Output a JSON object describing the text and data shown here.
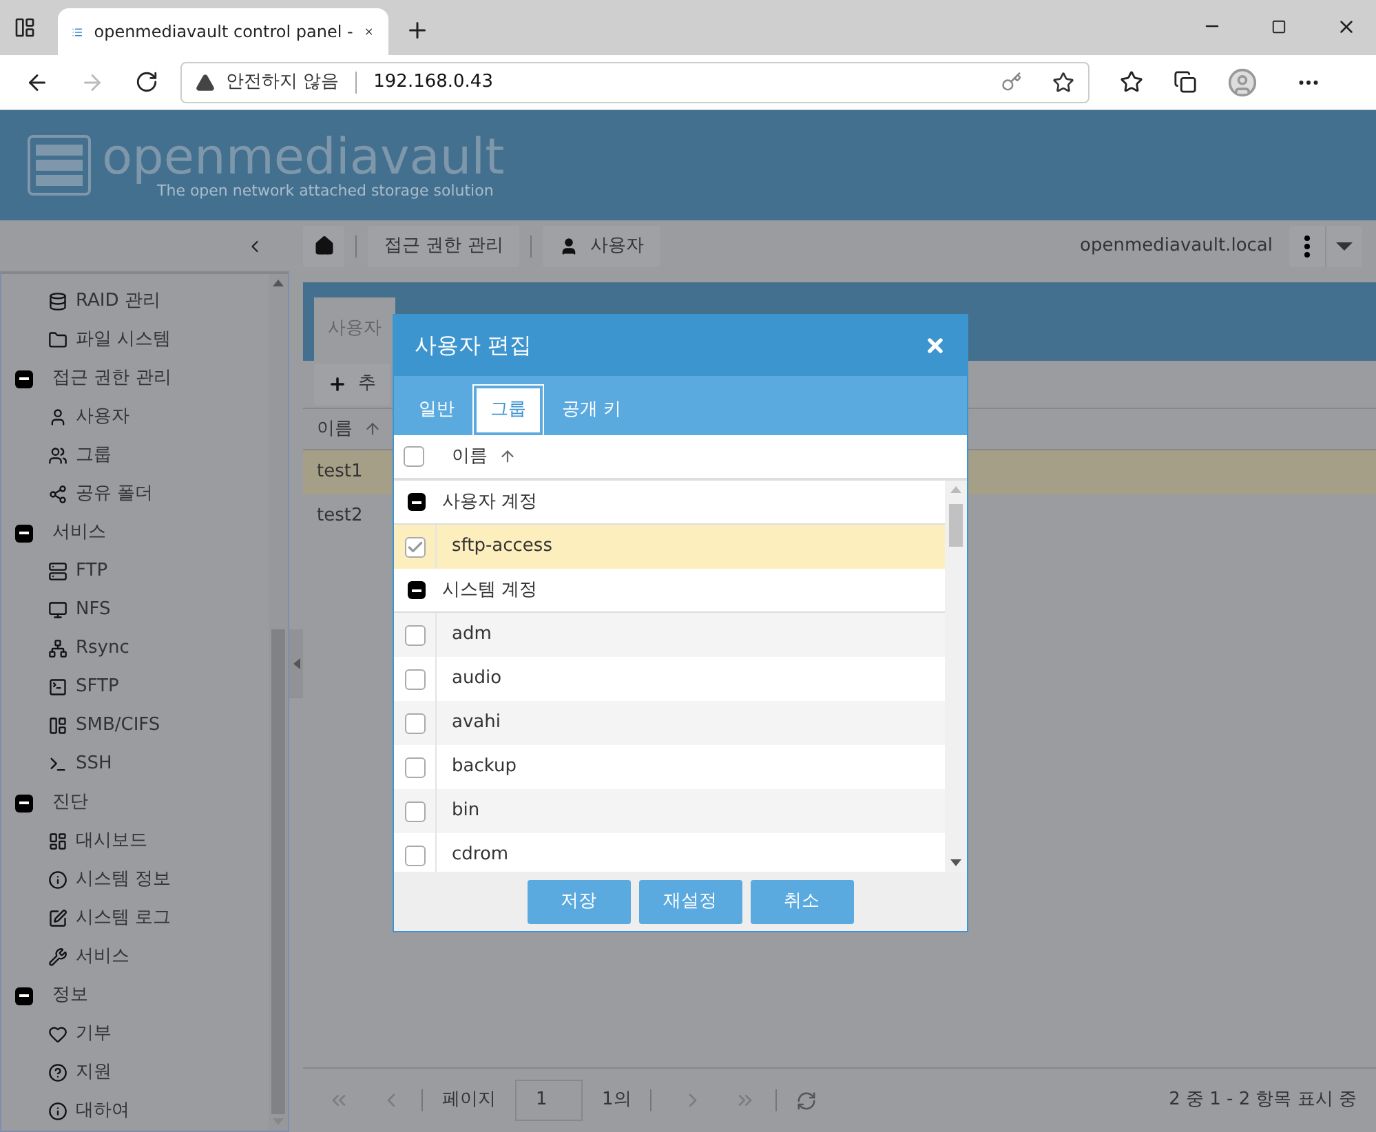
{
  "browser": {
    "tab_title": "openmediavault control panel -",
    "security": "안전하지 않음",
    "url": "192.168.0.43"
  },
  "header": {
    "logo": "openmediavault",
    "tagline": "The open network attached storage solution"
  },
  "toolbar": {
    "breadcrumbs": [
      "접근 권한 관리",
      "사용자"
    ],
    "hostname": "openmediavault.local"
  },
  "sidebar": {
    "items": [
      {
        "label": "RAID 관리"
      },
      {
        "label": "파일 시스템"
      },
      {
        "label": "접근 권한 관리",
        "expanded": true,
        "children": [
          {
            "label": "사용자"
          },
          {
            "label": "그룹"
          },
          {
            "label": "공유 폴더"
          }
        ]
      },
      {
        "label": "서비스",
        "expanded": true,
        "children": [
          {
            "label": "FTP"
          },
          {
            "label": "NFS"
          },
          {
            "label": "Rsync"
          },
          {
            "label": "SFTP"
          },
          {
            "label": "SMB/CIFS"
          },
          {
            "label": "SSH"
          }
        ]
      },
      {
        "label": "진단",
        "expanded": true,
        "children": [
          {
            "label": "대시보드"
          },
          {
            "label": "시스템 정보"
          },
          {
            "label": "시스템 로그"
          },
          {
            "label": "서비스"
          }
        ]
      },
      {
        "label": "정보",
        "expanded": true,
        "children": [
          {
            "label": "기부"
          },
          {
            "label": "지원"
          },
          {
            "label": "대하여"
          }
        ]
      }
    ]
  },
  "main": {
    "tabs": [
      {
        "label": "사용자",
        "selected": true
      }
    ],
    "add_button": "추",
    "column": "이름",
    "rows": [
      {
        "name": "test1",
        "selected": true
      },
      {
        "name": "test2",
        "selected": false
      }
    ],
    "paging": {
      "page_label": "페이지",
      "page": "1",
      "of": "1의",
      "summary": "2 중 1 - 2 항목 표시 중"
    }
  },
  "dialog": {
    "title": "사용자 편집",
    "tabs": [
      {
        "label": "일반",
        "selected": false
      },
      {
        "label": "그룹",
        "selected": true
      },
      {
        "label": "공개 키",
        "selected": false
      }
    ],
    "column": "이름",
    "select_all_checked": false,
    "groups": [
      {
        "label": "사용자 계정",
        "expanded": true,
        "rows": [
          {
            "name": "sftp-access",
            "checked": true,
            "selected": true
          }
        ]
      },
      {
        "label": "시스템 계정",
        "expanded": true,
        "rows": [
          {
            "name": "adm",
            "checked": false,
            "selected": false
          },
          {
            "name": "audio",
            "checked": false,
            "selected": false
          },
          {
            "name": "avahi",
            "checked": false,
            "selected": false
          },
          {
            "name": "backup",
            "checked": false,
            "selected": false
          },
          {
            "name": "bin",
            "checked": false,
            "selected": false
          },
          {
            "name": "cdrom",
            "checked": false,
            "selected": false
          }
        ]
      }
    ],
    "buttons": [
      "저장",
      "재설정",
      "취소"
    ]
  }
}
